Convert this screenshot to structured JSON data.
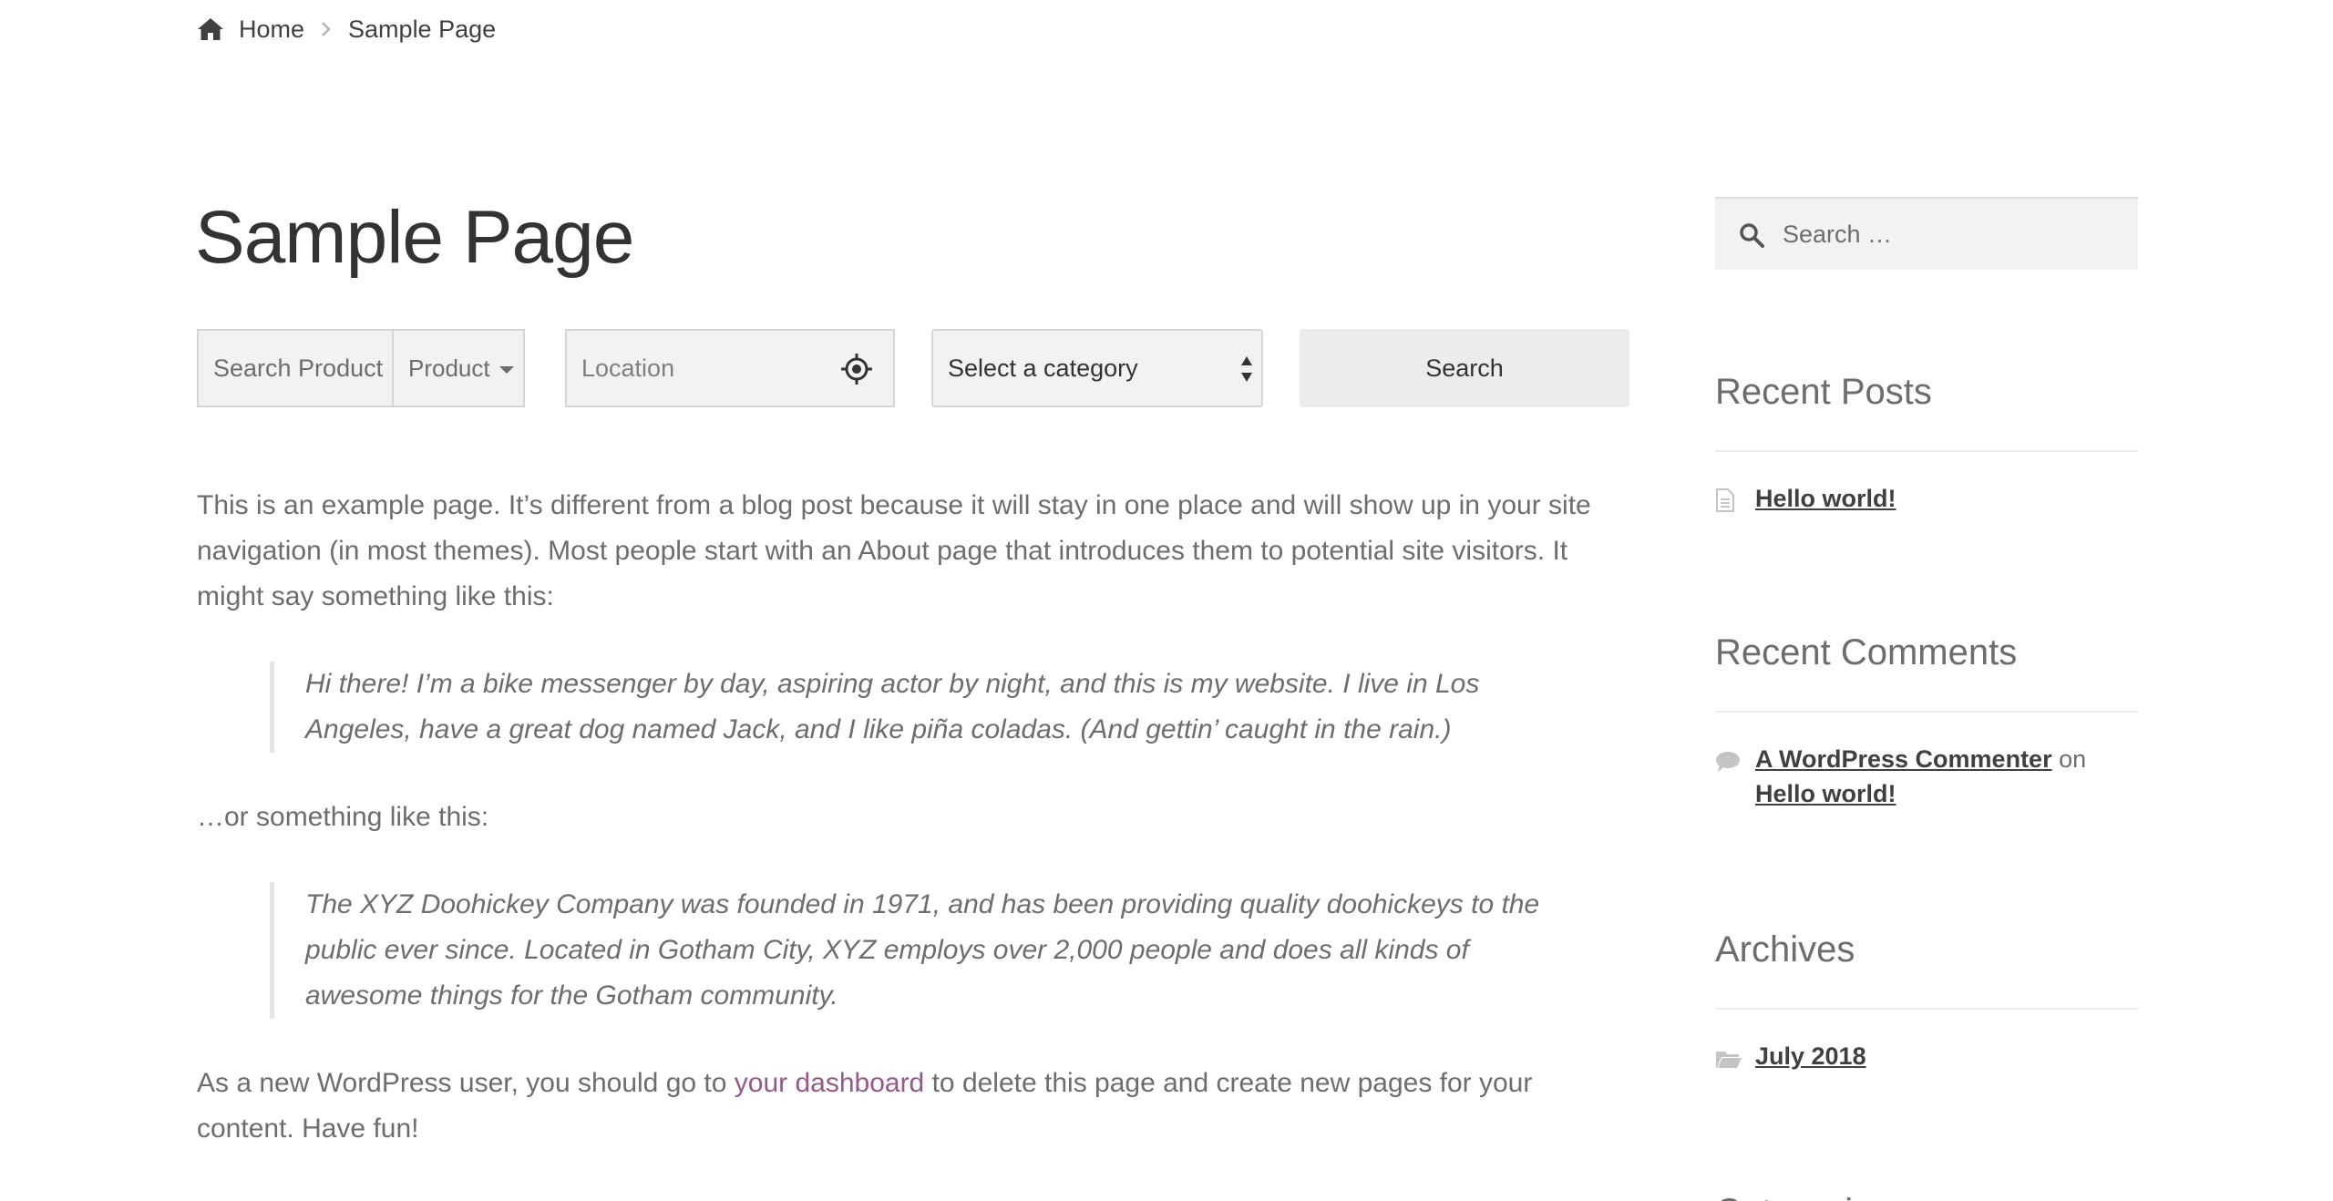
{
  "breadcrumb": {
    "home_label": "Home",
    "current_label": "Sample Page"
  },
  "page": {
    "title": "Sample Page"
  },
  "search_bar": {
    "product_search_label": "Search Product",
    "product_type_label": "Product",
    "location_placeholder": "Location",
    "category_select_value": "Select a category",
    "search_button_label": "Search"
  },
  "content": {
    "paragraph1": "This is an example page. It’s different from a blog post because it will stay in one place and will show up in your site navigation (in most themes). Most people start with an About page that introduces them to potential site visitors. It might say something like this:",
    "quote1": "Hi there! I’m a bike messenger by day, aspiring actor by night, and this is my website. I live in Los Angeles, have a great dog named Jack, and I like piña coladas. (And gettin’ caught in the rain.)",
    "paragraph2": "…or something like this:",
    "quote2": "The XYZ Doohickey Company was founded in 1971, and has been providing quality doohickeys to the public ever since. Located in Gotham City, XYZ employs over 2,000 people and does all kinds of awesome things for the Gotham community.",
    "paragraph3_before": "As a new WordPress user, you should go to ",
    "paragraph3_link": "your dashboard",
    "paragraph3_after": " to delete this page and create new pages for your content. Have fun!"
  },
  "sidebar": {
    "search_placeholder": "Search …",
    "recent_posts": {
      "title": "Recent Posts",
      "items": [
        {
          "label": "Hello world!",
          "icon": "document-icon"
        }
      ]
    },
    "recent_comments": {
      "title": "Recent Comments",
      "items": [
        {
          "author": "A WordPress Commenter",
          "connector": "on",
          "post": "Hello world!",
          "icon": "comment-icon"
        }
      ]
    },
    "archives": {
      "title": "Archives",
      "items": [
        {
          "label": "July 2018",
          "icon": "folder-icon"
        }
      ]
    },
    "categories": {
      "title": "Categories"
    }
  },
  "colors": {
    "link_accent": "#96588a",
    "text": "#6d6d6d",
    "heading": "#333333",
    "field_bg": "#f2f2f2"
  }
}
